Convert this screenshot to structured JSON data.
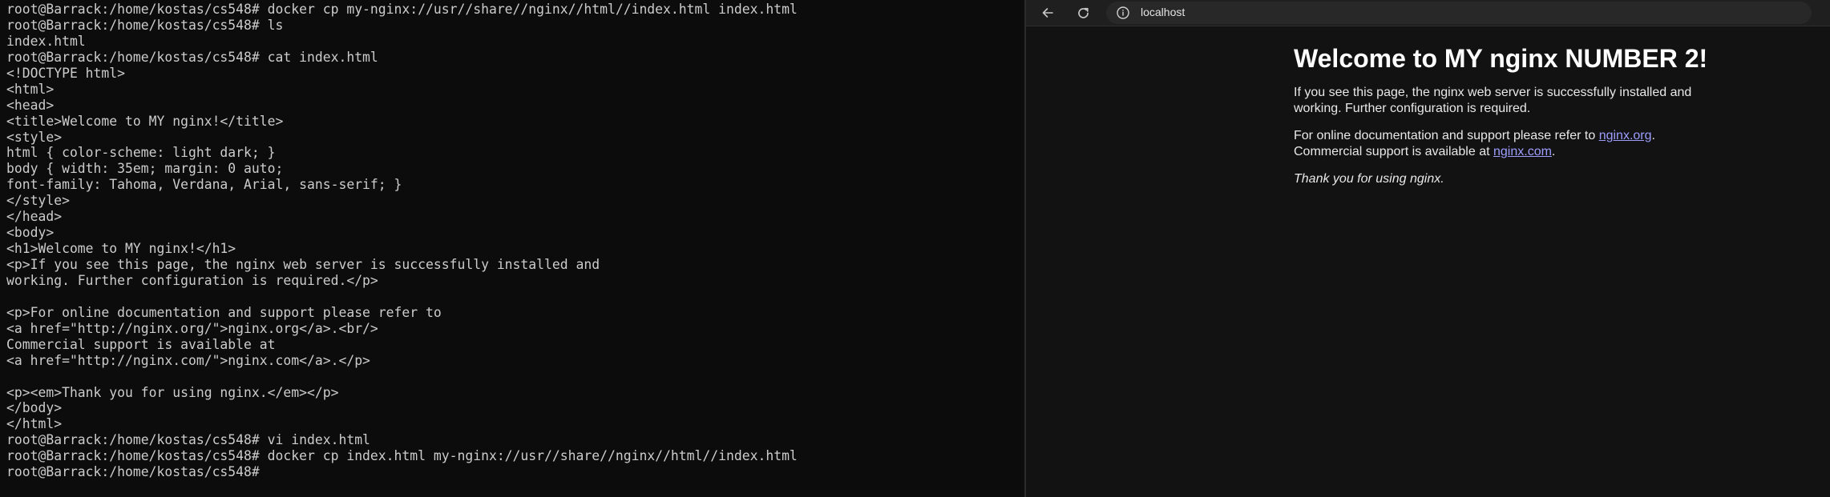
{
  "terminal": {
    "lines": [
      "root@Barrack:/home/kostas/cs548# docker cp my-nginx://usr//share//nginx//html//index.html index.html",
      "root@Barrack:/home/kostas/cs548# ls",
      "index.html",
      "root@Barrack:/home/kostas/cs548# cat index.html",
      "<!DOCTYPE html>",
      "<html>",
      "<head>",
      "<title>Welcome to MY nginx!</title>",
      "<style>",
      "html { color-scheme: light dark; }",
      "body { width: 35em; margin: 0 auto;",
      "font-family: Tahoma, Verdana, Arial, sans-serif; }",
      "</style>",
      "</head>",
      "<body>",
      "<h1>Welcome to MY nginx!</h1>",
      "<p>If you see this page, the nginx web server is successfully installed and",
      "working. Further configuration is required.</p>",
      "",
      "<p>For online documentation and support please refer to",
      "<a href=\"http://nginx.org/\">nginx.org</a>.<br/>",
      "Commercial support is available at",
      "<a href=\"http://nginx.com/\">nginx.com</a>.</p>",
      "",
      "<p><em>Thank you for using nginx.</em></p>",
      "</body>",
      "</html>",
      "root@Barrack:/home/kostas/cs548# vi index.html",
      "root@Barrack:/home/kostas/cs548# docker cp index.html my-nginx://usr//share//nginx//html//index.html",
      "root@Barrack:/home/kostas/cs548#"
    ]
  },
  "browser": {
    "toolbar": {
      "back_icon": "arrow-left-icon",
      "reload_icon": "reload-icon",
      "info_icon": "info-icon",
      "url": "localhost"
    },
    "page": {
      "heading": "Welcome to MY nginx NUMBER 2!",
      "p1": "If you see this page, the nginx web server is successfully installed and working. Further configuration is required.",
      "p2_text1": "For online documentation and support please refer to ",
      "p2_link1": "nginx.org",
      "p2_after_link1": ".",
      "p2_text2": "Commercial support is available at ",
      "p2_link2": "nginx.com",
      "p2_after_link2": ".",
      "p3": "Thank you for using nginx."
    }
  },
  "colors": {
    "terminal_bg": "#0c0c0c",
    "terminal_text": "#cccccc",
    "browser_bg": "#121212",
    "link": "#9e9eff"
  }
}
